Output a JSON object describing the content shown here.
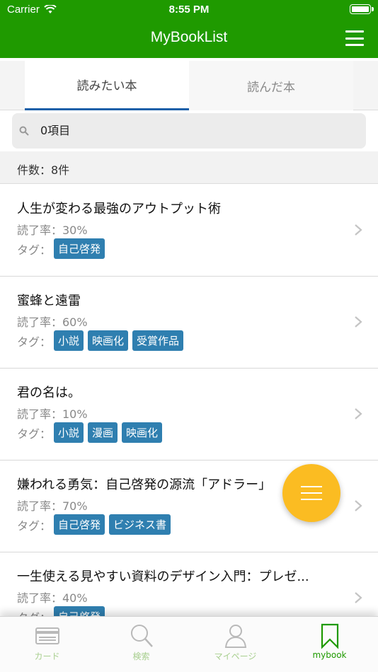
{
  "status": {
    "carrier": "Carrier",
    "time": "8:55 PM"
  },
  "nav": {
    "title": "MyBookList"
  },
  "tabs": [
    {
      "label": "読みたい本",
      "active": true
    },
    {
      "label": "読んだ本",
      "active": false
    }
  ],
  "search": {
    "value": "0項目"
  },
  "count": {
    "text": "件数：8件"
  },
  "books": [
    {
      "title": "人生が変わる最強のアウトプット術",
      "rate": "読了率：30%",
      "tag_label": "タグ：",
      "tags": [
        "自己啓発"
      ]
    },
    {
      "title": "蜜蜂と遠雷",
      "rate": "読了率：60%",
      "tag_label": "タグ：",
      "tags": [
        "小説",
        "映画化",
        "受賞作品"
      ]
    },
    {
      "title": "君の名は。",
      "rate": "読了率：10%",
      "tag_label": "タグ：",
      "tags": [
        "小説",
        "漫画",
        "映画化"
      ]
    },
    {
      "title": "嫌われる勇気：自己啓発の源流「アドラー」",
      "rate": "読了率：70%",
      "tag_label": "タグ：",
      "tags": [
        "自己啓発",
        "ビジネス書"
      ]
    },
    {
      "title": "一生使える見やすい資料のデザイン入門：プレゼ...",
      "rate": "読了率：40%",
      "tag_label": "タグ：",
      "tags": [
        "自己啓発"
      ]
    }
  ],
  "tabbar": [
    {
      "label": "カード",
      "icon": "card-icon",
      "active": false
    },
    {
      "label": "検索",
      "icon": "search-icon",
      "active": false
    },
    {
      "label": "マイページ",
      "icon": "person-icon",
      "active": false
    },
    {
      "label": "mybook",
      "icon": "bookmark-icon",
      "active": true
    }
  ],
  "colors": {
    "brand": "#1f9a00",
    "tag": "#2f7fb0",
    "fab": "#fbbc22",
    "tab_underline": "#1b5fa8"
  }
}
